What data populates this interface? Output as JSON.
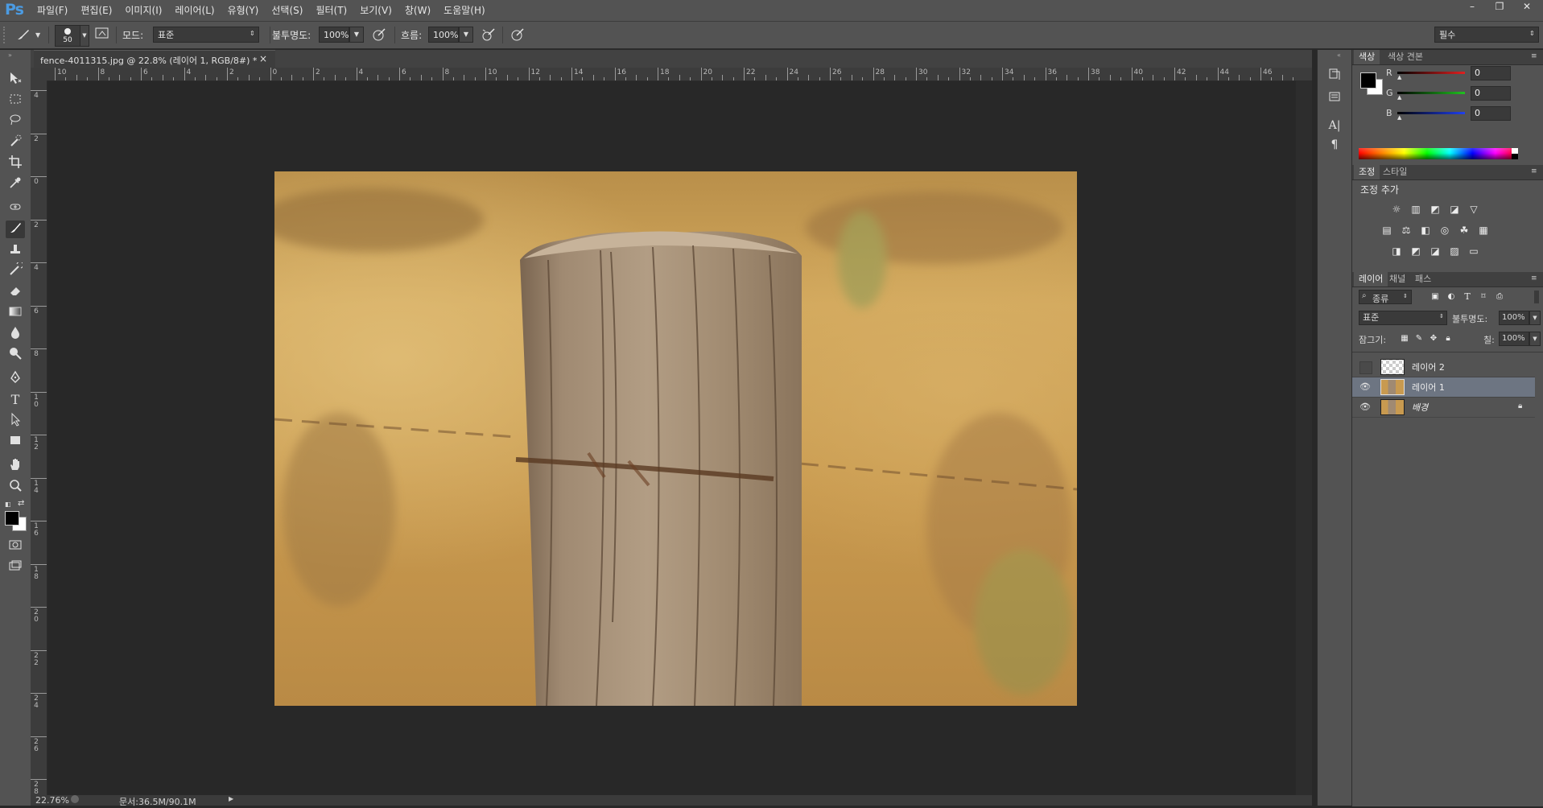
{
  "app": {
    "logo": "Ps"
  },
  "menu": [
    "파일(F)",
    "편집(E)",
    "이미지(I)",
    "레이어(L)",
    "유형(Y)",
    "선택(S)",
    "필터(T)",
    "보기(V)",
    "창(W)",
    "도움말(H)"
  ],
  "window_controls": {
    "minimize": "–",
    "restore": "❐",
    "close": "✕"
  },
  "options": {
    "brush_size": "50",
    "mode_label": "모드:",
    "mode_value": "표준",
    "opacity_label": "불투명도:",
    "opacity_value": "100%",
    "flow_label": "흐름:",
    "flow_value": "100%",
    "workspace": "필수"
  },
  "document": {
    "tab_title": "fence-4011315.jpg @ 22.8% (레이어 1, RGB/8#) *",
    "tab_close": "×",
    "zoom": "22.76%",
    "doc_info": "문서:36.5M/90.1M",
    "ruler_top_labels": [
      "10",
      "8",
      "6",
      "4",
      "2",
      "0",
      "2",
      "4",
      "6",
      "8",
      "10",
      "12",
      "14",
      "16",
      "18",
      "20",
      "22",
      "24",
      "26",
      "28",
      "30",
      "32",
      "34",
      "36",
      "38",
      "40",
      "42",
      "44",
      "46"
    ],
    "ruler_left_labels": [
      "4",
      "2",
      "0",
      "2",
      "4",
      "6",
      "8",
      "10",
      "12",
      "14",
      "16",
      "18",
      "20",
      "22",
      "24",
      "26",
      "28"
    ]
  },
  "color_panel": {
    "tabs": [
      "색상",
      "색상 견본"
    ],
    "channels": [
      {
        "name": "R",
        "value": "0",
        "color": "#d42020"
      },
      {
        "name": "G",
        "value": "0",
        "color": "#20b020"
      },
      {
        "name": "B",
        "value": "0",
        "color": "#2040e0"
      }
    ]
  },
  "adjust_panel": {
    "tabs": [
      "조정",
      "스타일"
    ],
    "title": "조정 추가",
    "icons_row1": [
      "☼",
      "▥",
      "◩",
      "◪",
      "▽"
    ],
    "icons_row2": [
      "▤",
      "⚖",
      "◧",
      "◎",
      "☘",
      "▦"
    ],
    "icons_row3": [
      "◨",
      "◩",
      "◪",
      "▨",
      "▭"
    ]
  },
  "layers_panel": {
    "tabs": [
      "레이어",
      "채널",
      "패스"
    ],
    "filter_kind": "종류",
    "blend_mode": "표준",
    "opacity_label": "불투명도:",
    "opacity_value": "100%",
    "lock_label": "잠그기:",
    "fill_label": "칠:",
    "fill_value": "100%",
    "layers": [
      {
        "name": "레이어 2",
        "visible": false,
        "selected": false
      },
      {
        "name": "레이어 1",
        "visible": true,
        "selected": true
      },
      {
        "name": "배경",
        "visible": true,
        "selected": false,
        "locked": true
      }
    ]
  },
  "tools": [
    "move-tool-icon",
    "marquee-tool-icon",
    "lasso-tool-icon",
    "quick-select-icon",
    "crop-tool-icon",
    "eyedropper-icon",
    "healing-brush-icon",
    "brush-tool-icon",
    "clone-stamp-icon",
    "history-brush-icon",
    "eraser-icon",
    "gradient-icon",
    "blur-icon",
    "dodge-icon",
    "pen-tool-icon",
    "type-tool-icon",
    "path-select-icon",
    "shape-tool-icon",
    "hand-tool-icon",
    "zoom-tool-icon"
  ]
}
